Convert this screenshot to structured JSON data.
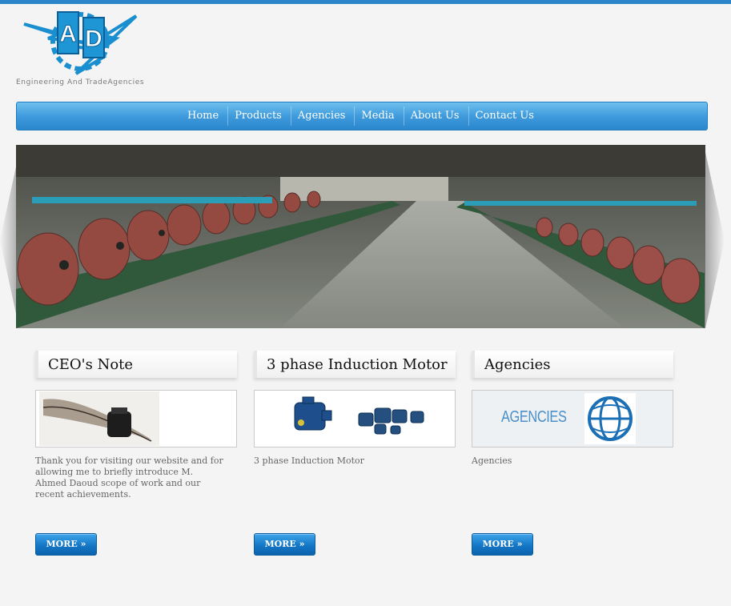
{
  "brand": {
    "logo_letters": "AD",
    "tagline": "Engineering And TradeAgencies",
    "accent": "#2a86c8"
  },
  "nav": {
    "items": [
      "Home",
      "Products",
      "Agencies",
      "Media",
      "About Us",
      "Contact Us"
    ]
  },
  "banner": {
    "alt_subject": "factory-motors-photo"
  },
  "columns": [
    {
      "title": "CEO's Note",
      "text": "Thank you for visiting our website and for allowing me to briefly introduce M. Ahmed Daoud scope of work and our recent achievements.",
      "button": "MORE »"
    },
    {
      "title": "3 phase Induction Motor",
      "text": "3 phase Induction Motor",
      "button": "MORE »"
    },
    {
      "title": "Agencies",
      "text": "Agencies",
      "image_label": "AGENCIES",
      "button": "MORE »"
    }
  ]
}
